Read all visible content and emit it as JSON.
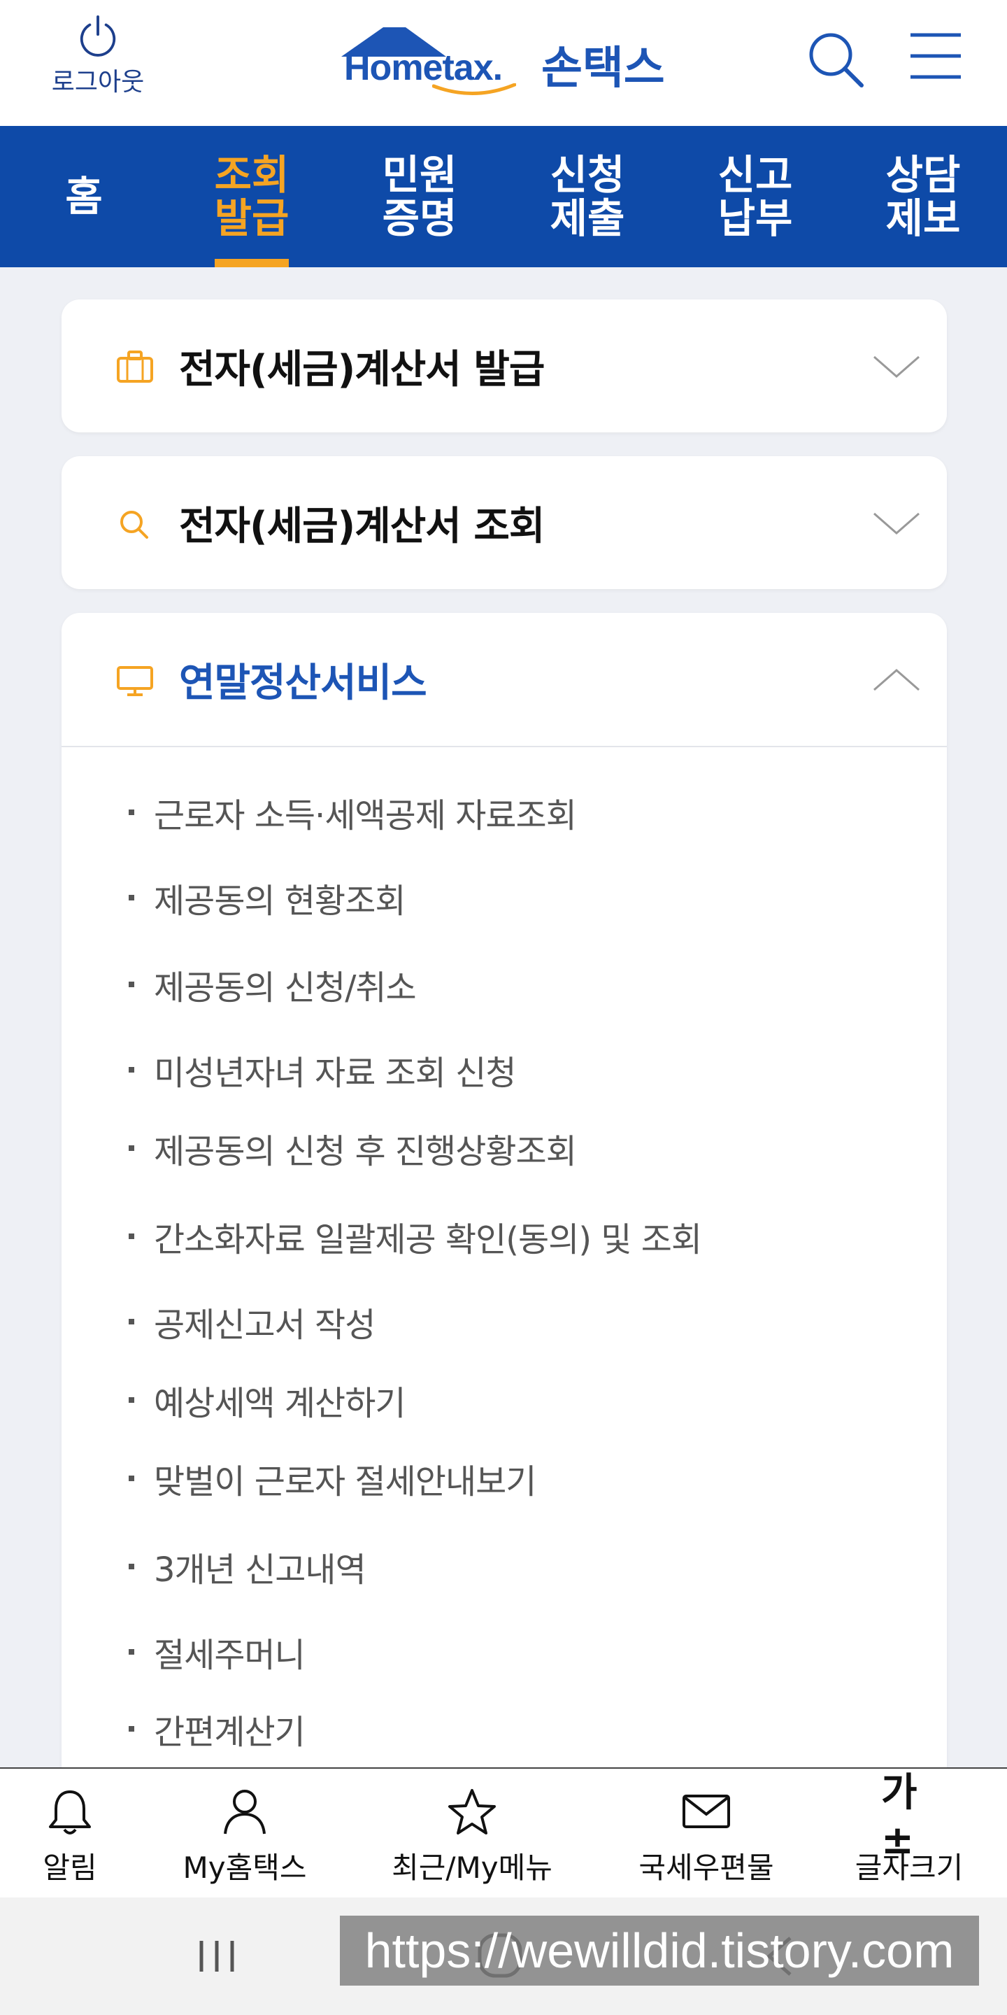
{
  "header": {
    "logout_label": "로그아웃",
    "logo_text": "Hometax.",
    "logo_ko": "손택스"
  },
  "nav": {
    "tabs": [
      {
        "label": "홈",
        "active": false
      },
      {
        "label": "조회\n발급",
        "active": true
      },
      {
        "label": "민원\n증명",
        "active": false
      },
      {
        "label": "신청\n제출",
        "active": false
      },
      {
        "label": "신고\n납부",
        "active": false
      },
      {
        "label": "상담\n제보",
        "active": false
      }
    ]
  },
  "cards": [
    {
      "title": "전자(세금)계산서 발급",
      "icon": "briefcase-icon",
      "expanded": false
    },
    {
      "title": "전자(세금)계산서 조회",
      "icon": "search-icon",
      "expanded": false
    },
    {
      "title": "연말정산서비스",
      "icon": "monitor-icon",
      "expanded": true,
      "items": [
        "근로자 소득·세액공제 자료조회",
        "제공동의 현황조회",
        "제공동의 신청/취소",
        "미성년자녀 자료 조회 신청",
        "제공동의 신청 후 진행상황조회",
        "간소화자료 일괄제공 확인(동의) 및 조회",
        "공제신고서 작성",
        "예상세액 계산하기",
        "맞벌이 근로자 절세안내보기",
        "3개년 신고내역",
        "절세주머니",
        "간편계산기"
      ]
    }
  ],
  "bottom_bar": [
    {
      "label": "알림",
      "icon": "bell-icon"
    },
    {
      "label": "My홈택스",
      "icon": "person-icon"
    },
    {
      "label": "최근/My메뉴",
      "icon": "star-icon"
    },
    {
      "label": "국세우편물",
      "icon": "mail-icon"
    },
    {
      "label": "글자크기",
      "icon": "font-size-icon",
      "glyph": "가±"
    }
  ],
  "watermark": "https://wewilldid.tistory.com",
  "colors": {
    "brand_blue": "#0e4aa8",
    "accent_orange": "#f5a423",
    "link_blue": "#1d55b5"
  }
}
